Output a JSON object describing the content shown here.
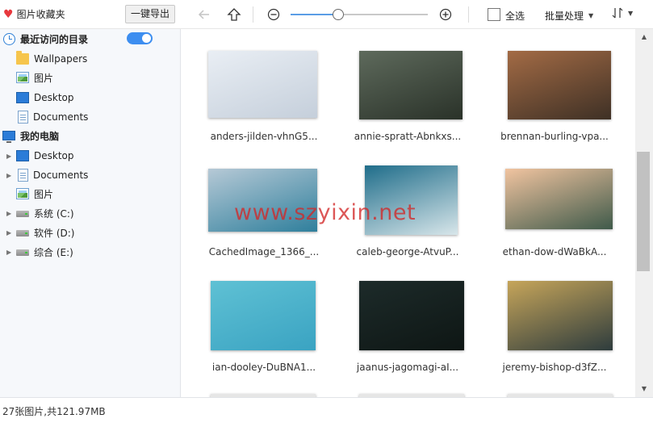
{
  "app": {
    "title": "图片收藏夹"
  },
  "toolbar": {
    "export_label": "一键导出",
    "zoom_level": 0.35,
    "select_all_label": "全选",
    "batch_label": "批量处理",
    "sort_icon": "sort-arrows-icon"
  },
  "sidebar": {
    "recent": {
      "label": "最近访问的目录",
      "toggle_on": true,
      "items": [
        {
          "label": "Wallpapers",
          "icon": "folder-icon"
        },
        {
          "label": "图片",
          "icon": "pictures-icon"
        },
        {
          "label": "Desktop",
          "icon": "desktop-icon"
        },
        {
          "label": "Documents",
          "icon": "documents-icon"
        }
      ]
    },
    "computer": {
      "label": "我的电脑",
      "items": [
        {
          "label": "Desktop",
          "icon": "desktop-icon"
        },
        {
          "label": "Documents",
          "icon": "documents-icon"
        },
        {
          "label": "图片",
          "icon": "pictures-icon"
        },
        {
          "label": "系统 (C:)",
          "icon": "drive-icon"
        },
        {
          "label": "软件 (D:)",
          "icon": "drive-icon"
        },
        {
          "label": "综合 (E:)",
          "icon": "drive-icon"
        }
      ]
    }
  },
  "gallery": {
    "items": [
      {
        "name": "anders-jilden-vhnG5...",
        "colors": [
          "#e9eef4",
          "#c5cfdb"
        ]
      },
      {
        "name": "annie-spratt-Abnkxs...",
        "colors": [
          "#5e6a5c",
          "#2a3229"
        ]
      },
      {
        "name": "brennan-burling-vpa...",
        "colors": [
          "#a36b45",
          "#3e3025"
        ]
      },
      {
        "name": "CachedImage_1366_...",
        "colors": [
          "#b6c9d6",
          "#2f7f9c"
        ]
      },
      {
        "name": "caleb-george-AtvuP...",
        "colors": [
          "#1f6d8a",
          "#d8e6ea"
        ]
      },
      {
        "name": "ethan-dow-dWaBkA...",
        "colors": [
          "#f1c4a0",
          "#3f5a4a"
        ]
      },
      {
        "name": "ian-dooley-DuBNA1...",
        "colors": [
          "#5fc1d4",
          "#3aa3c2"
        ]
      },
      {
        "name": "jaanus-jagomagi-aI...",
        "colors": [
          "#1d2b2a",
          "#0e1614"
        ]
      },
      {
        "name": "jeremy-bishop-d3fZ...",
        "colors": [
          "#c6a55a",
          "#2e3c3d"
        ]
      }
    ]
  },
  "status": {
    "text": "27张图片,共121.97MB"
  },
  "watermark": "www.szyixin.net"
}
